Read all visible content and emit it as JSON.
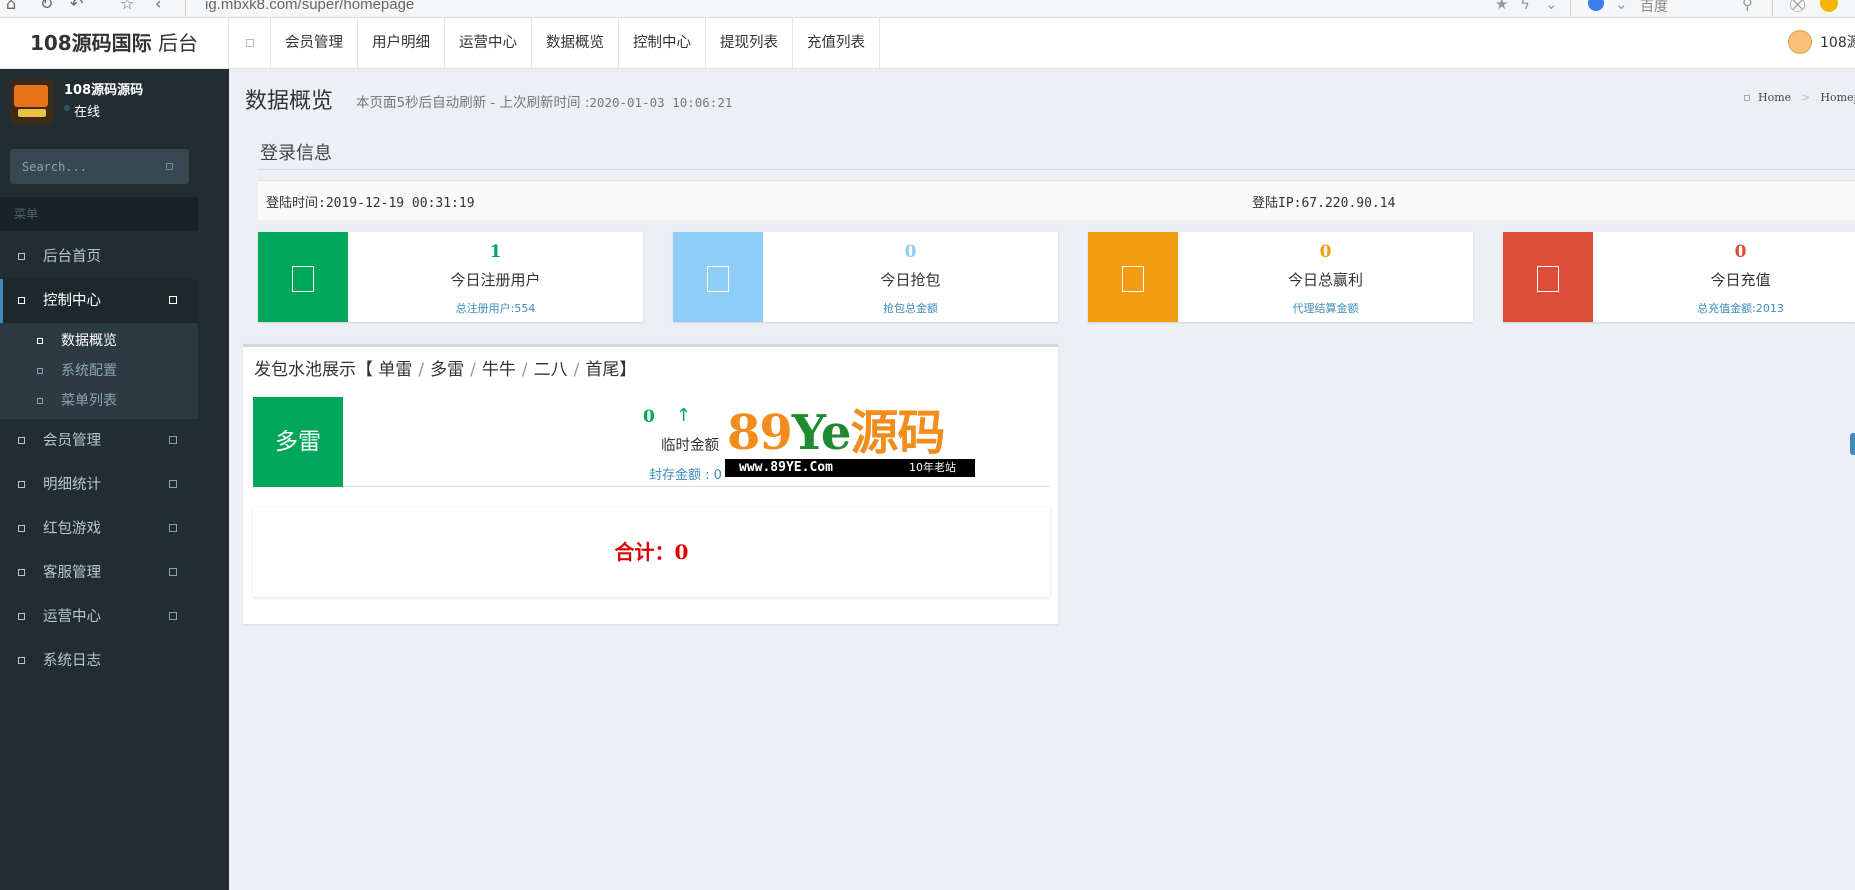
{
  "browser": {
    "url": "ig.mbxk8.com/super/homepage",
    "search_engine": "百度"
  },
  "header": {
    "brand_bold": "108源码国际",
    "brand_rest": " 后台",
    "nav": [
      "会员管理",
      "用户明细",
      "运营中心",
      "数据概览",
      "控制中心",
      "提现列表",
      "充值列表"
    ],
    "user_label": "108源"
  },
  "sidebar": {
    "user_name": "108源码源码",
    "user_status": "在线",
    "search_placeholder": "Search...",
    "menu_header": "菜单",
    "items": [
      {
        "label": "后台首页",
        "has_arrow": false
      },
      {
        "label": "控制中心",
        "has_arrow": true,
        "active": true,
        "children": [
          "数据概览",
          "系统配置",
          "菜单列表"
        ]
      },
      {
        "label": "会员管理",
        "has_arrow": true
      },
      {
        "label": "明细统计",
        "has_arrow": true
      },
      {
        "label": "红包游戏",
        "has_arrow": true
      },
      {
        "label": "客服管理",
        "has_arrow": true
      },
      {
        "label": "运营中心",
        "has_arrow": true
      },
      {
        "label": "系统日志",
        "has_arrow": false
      }
    ]
  },
  "page": {
    "title": "数据概览",
    "subtitle": "本页面5秒后自动刷新 - 上次刷新时间 :",
    "refresh_time": "2020-01-03 10:06:21",
    "breadcrumb": [
      "Home",
      "Homep"
    ]
  },
  "login": {
    "title": "登录信息",
    "time_label": "登陆时间:",
    "time_value": "2019-12-19 00:31:19",
    "ip_label": "登陆IP:",
    "ip_value": "67.220.90.14"
  },
  "stats": [
    {
      "value": "1",
      "label": "今日注册用户",
      "sub": "总注册用户:554",
      "color": "#00a65a"
    },
    {
      "value": "0",
      "label": "今日抢包",
      "sub": "抢包总金额",
      "color": "#8ecdf5"
    },
    {
      "value": "0",
      "label": "今日总赢利",
      "sub": "代理结算金额",
      "color": "#f39c12"
    },
    {
      "value": "0",
      "label": "今日充值",
      "sub": "总充值金额:2013",
      "color": "#dd4b39"
    }
  ],
  "pool": {
    "title_prefix": "发包水池展示【",
    "types": [
      "单雷",
      "多雷",
      "牛牛",
      "二八",
      "首尾"
    ],
    "title_suffix": "】",
    "box_label": "多雷",
    "amount": "0",
    "amount_label": "临时金额",
    "sealed_label": "封存金额 : 0",
    "total_label": "合计：",
    "total_value": "0"
  },
  "watermark": {
    "main_a": "89",
    "main_b": "Ye",
    "main_c": "源码",
    "domain": "www.89YE.Com",
    "tag": "10年老站"
  }
}
